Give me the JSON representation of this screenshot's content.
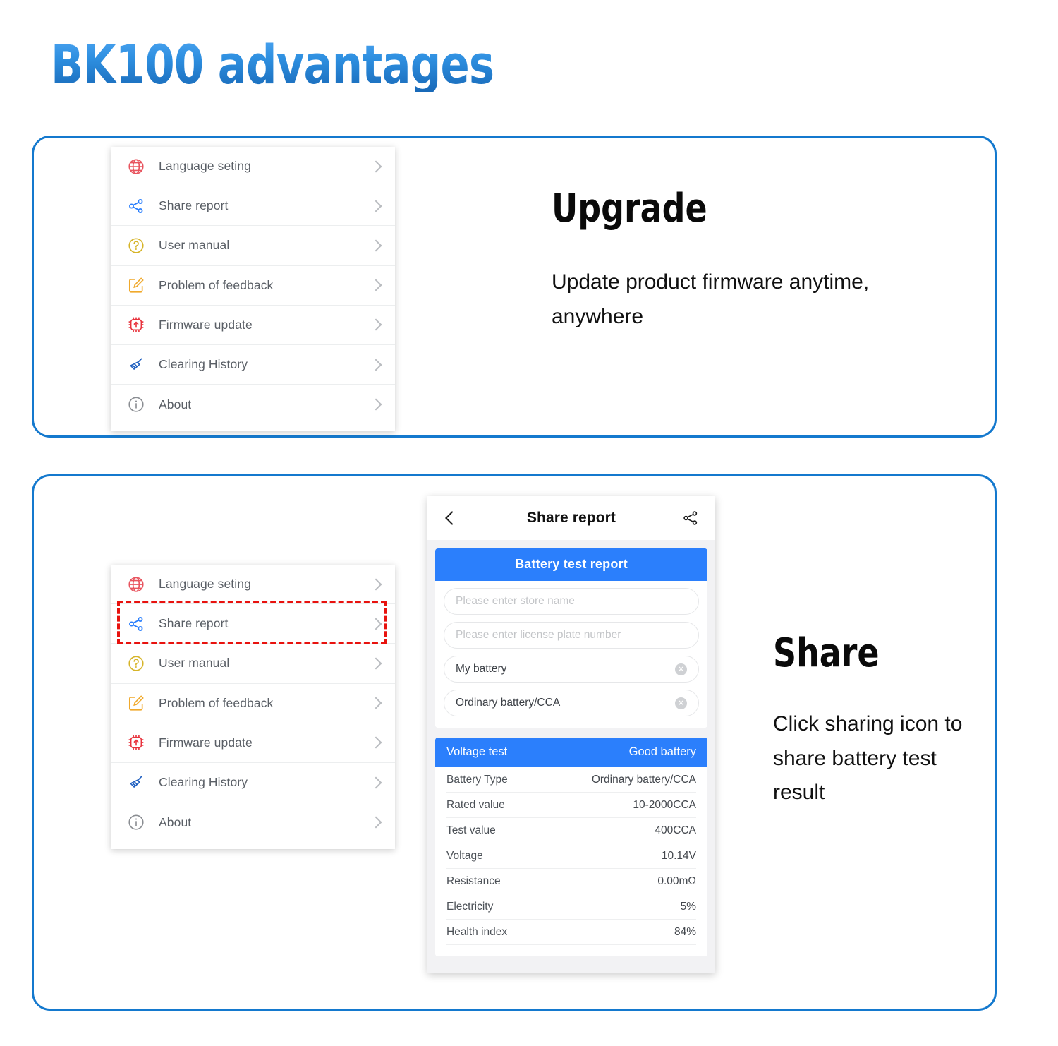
{
  "page": {
    "title": "BK100 advantages",
    "title_gradient_top": "#4aa3f0",
    "title_gradient_bottom": "#1869b8",
    "panel_border_color": "#1479ce",
    "accent_blue": "#2b7ffc",
    "highlight_color": "#e8120e"
  },
  "settings_menu": {
    "items": [
      {
        "label": "Language seting",
        "icon": "globe-icon",
        "icon_color": "#e8555f",
        "chevron": "chevron-right-icon"
      },
      {
        "label": "Share report",
        "icon": "share-nodes-icon",
        "icon_color": "#2b7ffc",
        "chevron": "chevron-right-icon"
      },
      {
        "label": "User manual",
        "icon": "question-circle-icon",
        "icon_color": "#d6b428",
        "chevron": "chevron-right-icon"
      },
      {
        "label": "Problem of feedback",
        "icon": "edit-note-icon",
        "icon_color": "#f0a92c",
        "chevron": "chevron-right-icon"
      },
      {
        "label": "Firmware update",
        "icon": "chip-upload-icon",
        "icon_color": "#e8323c",
        "chevron": "chevron-right-icon"
      },
      {
        "label": "Clearing History",
        "icon": "broom-icon",
        "icon_color": "#1e5fc0",
        "chevron": "chevron-right-icon"
      },
      {
        "label": "About",
        "icon": "info-circle-icon",
        "icon_color": "#8a8d92",
        "chevron": "chevron-right-icon"
      }
    ]
  },
  "upgrade_blurb": {
    "heading": "Upgrade",
    "body": "Update product firmware anytime, anywhere"
  },
  "share_blurb": {
    "heading": "Share",
    "body": "Click sharing icon to share battery test result"
  },
  "phone": {
    "header": {
      "back": "back-arrow-icon",
      "title": "Share report",
      "share": "share-nodes-icon"
    },
    "report_banner": "Battery test report",
    "fields": [
      {
        "placeholder": "Please enter store name",
        "value": "",
        "clearable": false
      },
      {
        "placeholder": "Please enter license plate number",
        "value": "",
        "clearable": false
      },
      {
        "placeholder": "",
        "value": "My battery",
        "clearable": true,
        "clear_icon": "clear-circle-icon"
      },
      {
        "placeholder": "",
        "value": "Ordinary battery/CCA",
        "clearable": true,
        "clear_icon": "clear-circle-icon"
      }
    ],
    "voltage_test": {
      "header_left": "Voltage test",
      "header_right": "Good battery",
      "rows": [
        {
          "key": "Battery Type",
          "value": "Ordinary battery/CCA"
        },
        {
          "key": "Rated value",
          "value": "10-2000CCA"
        },
        {
          "key": "Test value",
          "value": "400CCA"
        },
        {
          "key": "Voltage",
          "value": "10.14V"
        },
        {
          "key": "Resistance",
          "value": "0.00mΩ"
        },
        {
          "key": "Electricity",
          "value": "5%"
        },
        {
          "key": "Health index",
          "value": "84%"
        }
      ]
    }
  }
}
